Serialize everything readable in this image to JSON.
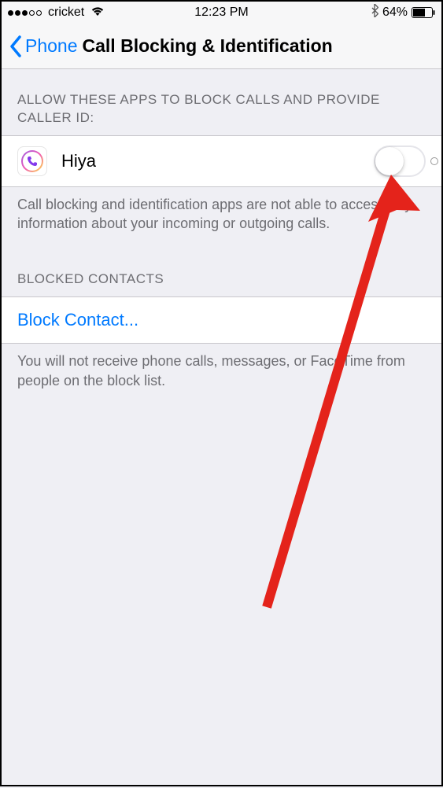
{
  "statusBar": {
    "carrier": "cricket",
    "time": "12:23 PM",
    "batteryPercent": "64%"
  },
  "nav": {
    "backLabel": "Phone",
    "title": "Call Blocking & Identification"
  },
  "sections": {
    "apps": {
      "header": "ALLOW THESE APPS TO BLOCK CALLS AND PROVIDE CALLER ID:",
      "items": [
        {
          "name": "Hiya",
          "enabled": false
        }
      ],
      "footer": "Call blocking and identification apps are not able to access any information about your incoming or outgoing calls."
    },
    "blocked": {
      "header": "BLOCKED CONTACTS",
      "link": "Block Contact...",
      "footer": "You will not receive phone calls, messages, or FaceTime from people on the block list."
    }
  }
}
